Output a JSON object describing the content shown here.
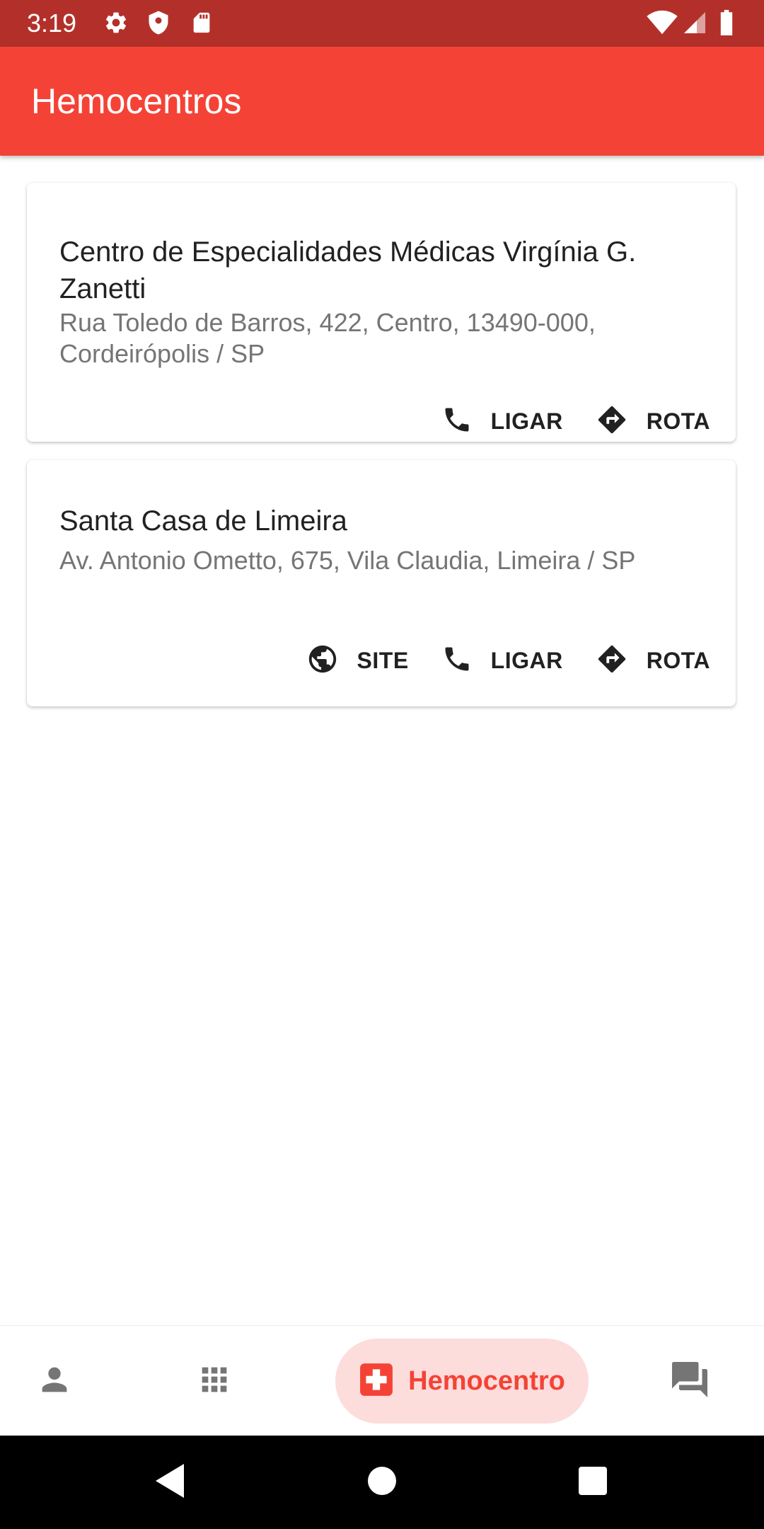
{
  "status_bar": {
    "time": "3:19",
    "left_icons": [
      "gear-icon",
      "shield-icon",
      "sd-card-icon"
    ],
    "right_icons": [
      "wifi-icon",
      "signal-icon",
      "battery-icon"
    ]
  },
  "app_bar": {
    "title": "Hemocentros",
    "color": "#f44336"
  },
  "cards": [
    {
      "name": "Centro de Especialidades Médicas Virgínia G. Zanetti",
      "address": "Rua Toledo de Barros, 422, Centro, 13490-000, Cordeirópolis / SP",
      "actions": [
        {
          "label": "LIGAR",
          "icon": "phone-icon"
        },
        {
          "label": "ROTA",
          "icon": "directions-icon"
        }
      ]
    },
    {
      "name": "Santa Casa de Limeira",
      "address": "Av. Antonio Ometto, 675, Vila Claudia, Limeira / SP",
      "actions": [
        {
          "label": "SITE",
          "icon": "globe-icon"
        },
        {
          "label": "LIGAR",
          "icon": "phone-icon"
        },
        {
          "label": "ROTA",
          "icon": "directions-icon"
        }
      ]
    }
  ],
  "bottom_nav": {
    "items": [
      {
        "icon": "person-icon",
        "label": ""
      },
      {
        "icon": "apps-grid-icon",
        "label": ""
      },
      {
        "icon": "medical-cross-icon",
        "label": "Hemocentro",
        "selected": true
      },
      {
        "icon": "forum-icon",
        "label": ""
      }
    ],
    "selected_color": "#f44336",
    "selected_bg": "#fddcdc"
  },
  "system_nav": [
    "back-icon",
    "home-icon",
    "recents-icon"
  ]
}
